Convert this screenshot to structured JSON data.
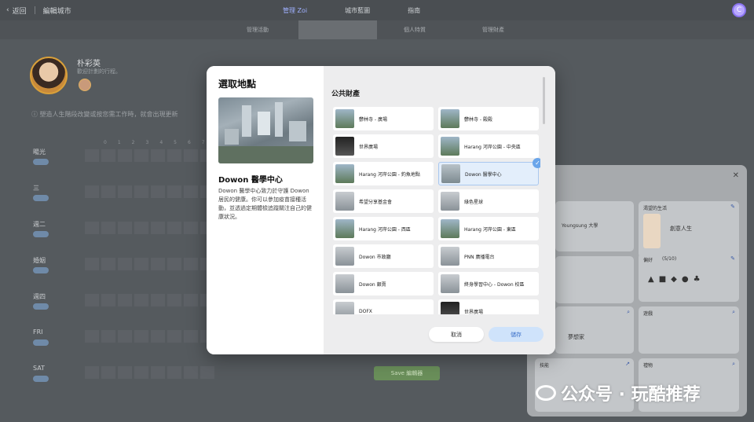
{
  "topbar": {
    "back_label": "返回",
    "title": "編輯城市",
    "tabs": [
      "管理 Zoi",
      "城市藍圖",
      "指南"
    ],
    "user_initial": "C"
  },
  "subbar": {
    "items": [
      "管理活動",
      "",
      "個人特質",
      "管理財產"
    ]
  },
  "profile": {
    "name": "朴彩英",
    "subtitle": "歡迎計劃的行程。",
    "info": "塑造人生階段改變或按您需工作時，就會出現更新"
  },
  "schedule": {
    "hours": [
      "0",
      "1",
      "2",
      "3",
      "4",
      "5",
      "6",
      "7"
    ],
    "days": [
      "暘光",
      "三",
      "週二",
      "婚姻",
      "週四",
      "FRI",
      "SAT"
    ],
    "button_label": "Save 編輯器"
  },
  "modal": {
    "title": "選取地點",
    "place_name": "Dowon 醫學中心",
    "place_desc": "Dowon 醫學中心致力於守護 Dowon 居民的健康。你可以參加疫苗接種活動，並透過定期體檢追蹤關注自己的健康狀況。",
    "section_title": "公共財產",
    "tiles": [
      "鬱林寺 - 廣場",
      "鬱林寺 - 殿殿",
      "世界廣場",
      "Harang 河岸公園 - 中央區",
      "Harang 河岸公園 - 釣魚地點",
      "Dowon 醫學中心",
      "希望分享基金會",
      "綠色星球",
      "Harang 河岸公園 - 西區",
      "Harang 河岸公園 - 東區",
      "Dowon 市政廳",
      "PNN 廣播電台",
      "Dowon 銀賣",
      "終身學習中心 - Dowon 校區",
      "DOFX",
      "世界廣場"
    ],
    "selected_index": 5,
    "cancel_label": "取消",
    "save_label": "儲存"
  },
  "right_panel": {
    "cards": [
      "渴望的生活",
      "偏好",
      "遊戲",
      "技能",
      "禮物"
    ],
    "card_life_label": "創意人生",
    "card_pref_count": "(5/10)",
    "card_game_label": "夢想家",
    "school_label": "Youngsung 大學"
  },
  "watermark": "公众号 · 玩酷推荐"
}
